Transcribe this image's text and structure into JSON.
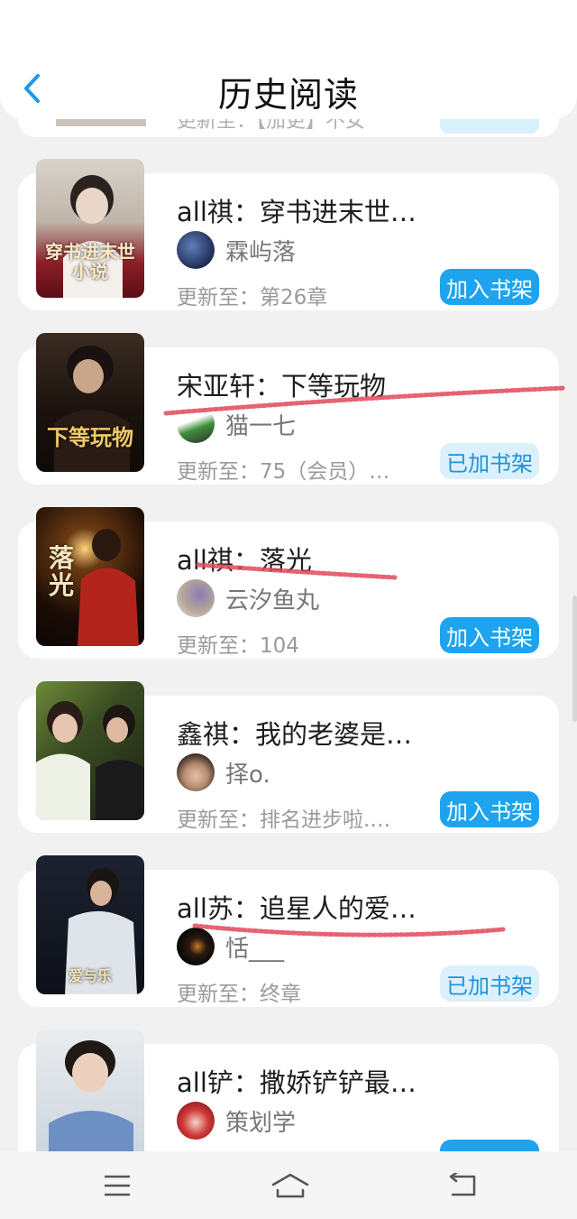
{
  "header": {
    "title": "历史阅读"
  },
  "partial_item": {
    "update_text": "更新至：【加更】不女"
  },
  "books": [
    {
      "title": "all祺：穿书进末世…",
      "author": "霖屿落",
      "update": "更新至：第26章",
      "button": "加入书架",
      "button_state": "add",
      "cover_text": "穿书进末世小说"
    },
    {
      "title": "宋亚轩：下等玩物",
      "author": "猫一七",
      "update": "更新至：75（会员）…",
      "button": "已加书架",
      "button_state": "added",
      "cover_text": "下等玩物"
    },
    {
      "title": "all祺：落光",
      "author": "云汐鱼丸",
      "update": "更新至：104",
      "button": "加入书架",
      "button_state": "add",
      "cover_text": "落光"
    },
    {
      "title": "鑫祺：我的老婆是…",
      "author": "择o.",
      "update": "更新至：排名进步啦.…",
      "button": "加入书架",
      "button_state": "add",
      "cover_text": ""
    },
    {
      "title": "all苏：追星人的爱…",
      "author": "恬___",
      "update": "更新至：终章",
      "button": "已加书架",
      "button_state": "added",
      "cover_text": "爱与乐"
    },
    {
      "title": "all铲：撒娇铲铲最…",
      "author": "策划学",
      "update": "",
      "button": "",
      "button_state": "add",
      "cover_text": ""
    }
  ],
  "colors": {
    "accent": "#1ea4ef",
    "added_bg": "#dcf0fb",
    "scribble": "#e0485a"
  }
}
